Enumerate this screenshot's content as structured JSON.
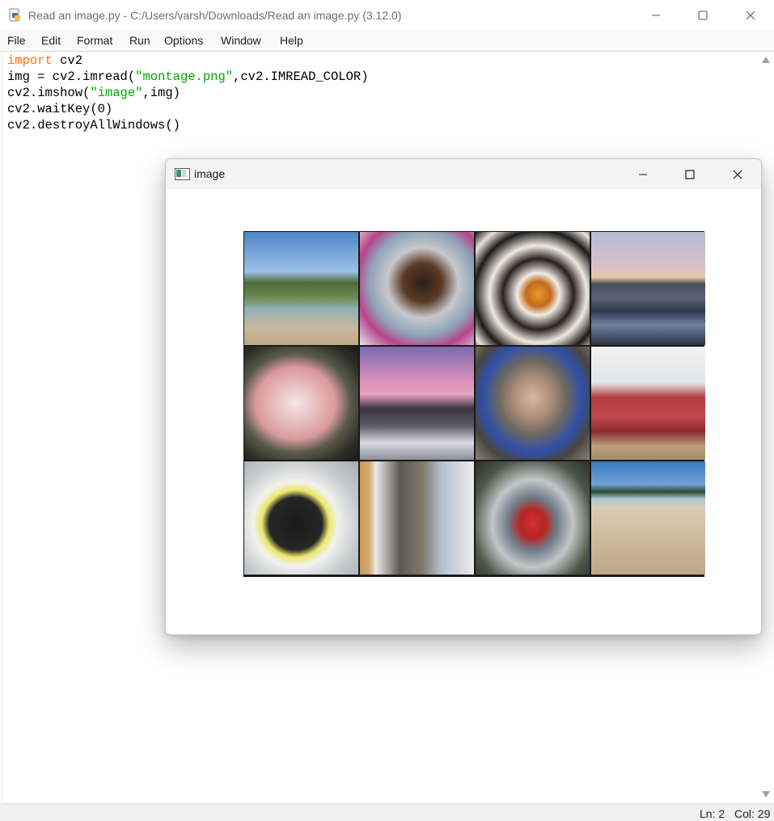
{
  "window": {
    "title": "Read an image.py - C:/Users/varsh/Downloads/Read an image.py (3.12.0)"
  },
  "menu": [
    "File",
    "Edit",
    "Format",
    "Run",
    "Options",
    "Window",
    "Help"
  ],
  "code": {
    "line1": {
      "kw": "import",
      "rest": " cv2"
    },
    "line2": {
      "a": "img = cv2.imread(",
      "s": "\"montage.png\"",
      "b": ",cv2.IMREAD_COLOR)"
    },
    "line3": {
      "a": "cv2.imshow(",
      "s": "\"image\"",
      "b": ",img)"
    },
    "line4": "cv2.waitKey(0)",
    "line5": "cv2.destroyAllWindows()"
  },
  "status": {
    "line": "Ln: 2",
    "col": "Col: 29"
  },
  "cv_window": {
    "title": "image"
  },
  "colors": {
    "keyword": "#ff7700",
    "string": "#00aa00",
    "menubar_bg": "#f9f9f9",
    "statusbar_bg": "#f0f0f0"
  },
  "icons": {
    "app": "python-idle-icon",
    "minimize": "minimize-icon",
    "maximize": "maximize-icon",
    "close": "close-icon",
    "cv_window": "image-window-icon"
  }
}
